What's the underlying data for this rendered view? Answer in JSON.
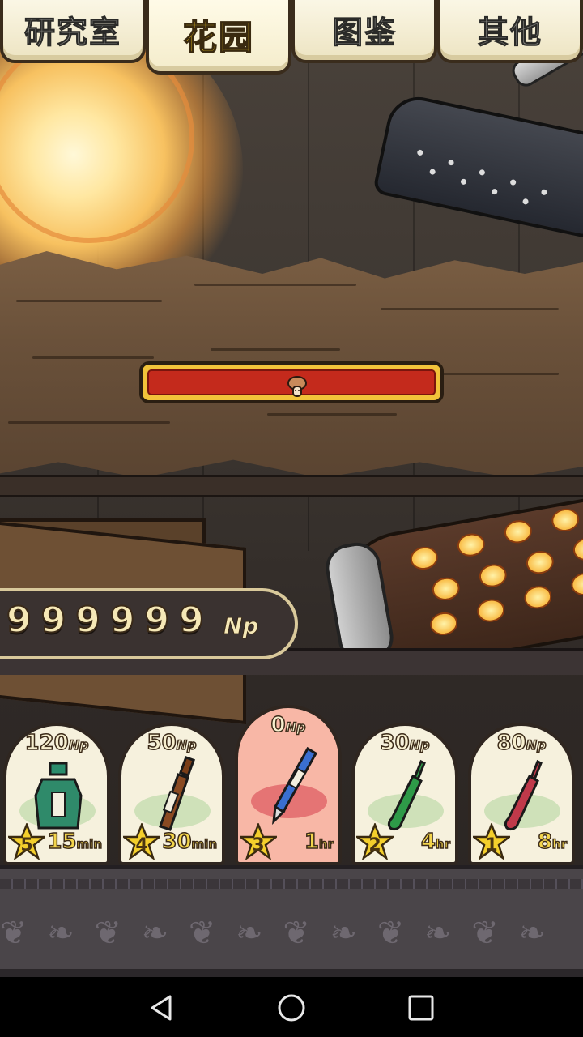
{
  "tabs": [
    {
      "label": "研究室",
      "active": false
    },
    {
      "label": "花园",
      "active": true
    },
    {
      "label": "图鉴",
      "active": false
    },
    {
      "label": "其他",
      "active": false
    }
  ],
  "progress": {
    "fill_fraction": 0.0
  },
  "currency": {
    "value": "999999",
    "unit": "Np"
  },
  "items": [
    {
      "price": "120",
      "price_unit": "Np",
      "rank": "5",
      "time": "15",
      "time_unit": "min",
      "icon": "green-bottle-icon",
      "color": "#2f8a6a",
      "selected": false
    },
    {
      "price": "50",
      "price_unit": "Np",
      "rank": "4",
      "time": "30",
      "time_unit": "min",
      "icon": "brown-bottle-icon",
      "color": "#8a4a22",
      "selected": false
    },
    {
      "price": "0",
      "price_unit": "Np",
      "rank": "3",
      "time": "1",
      "time_unit": "hr",
      "icon": "blue-pen-icon",
      "color": "#3a6fd0",
      "selected": true
    },
    {
      "price": "30",
      "price_unit": "Np",
      "rank": "2",
      "time": "4",
      "time_unit": "hr",
      "icon": "green-ampoule-icon",
      "color": "#2e9a48",
      "selected": false
    },
    {
      "price": "80",
      "price_unit": "Np",
      "rank": "1",
      "time": "8",
      "time_unit": "hr",
      "icon": "red-ampoule-icon",
      "color": "#c0394a",
      "selected": false
    }
  ],
  "navbar": {
    "back": "back-icon",
    "home": "home-icon",
    "recents": "recents-icon"
  }
}
